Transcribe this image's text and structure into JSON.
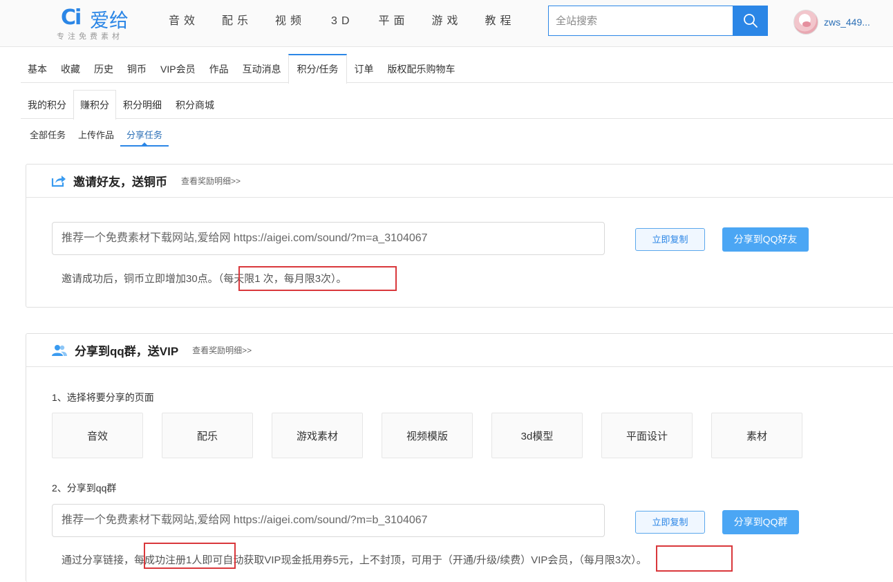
{
  "header": {
    "logo_mark": "Ci",
    "logo_name": "爱给",
    "logo_slogan": "专注免费素材",
    "nav": [
      "音效",
      "配乐",
      "视频",
      "3D",
      "平面",
      "游戏",
      "教程"
    ],
    "search_placeholder": "全站搜索",
    "username": "zws_449..."
  },
  "tabs_primary": {
    "items": [
      "基本",
      "收藏",
      "历史",
      "铜币",
      "VIP会员",
      "作品",
      "互动消息",
      "积分/任务",
      "订单",
      "版权配乐购物车"
    ],
    "active": "积分/任务"
  },
  "tabs_secondary": {
    "items": [
      "我的积分",
      "赚积分",
      "积分明细",
      "积分商城"
    ],
    "active": "赚积分"
  },
  "tabs_tertiary": {
    "items": [
      "全部任务",
      "上传作品",
      "分享任务"
    ],
    "active": "分享任务"
  },
  "invite": {
    "title": "邀请好友，送铜币",
    "detail_link": "查看奖励明细>>",
    "link_text": "推荐一个免费素材下载网站,爱给网   https://aigei.com/sound/?m=a_3104067",
    "copy_button": "立即复制",
    "share_button": "分享到QQ好友",
    "note_prefix": "邀请成功后，铜币立即增加30点。",
    "note_limit": "（每天限1 次，每月限3次）",
    "note_end": "。"
  },
  "share_group": {
    "title": "分享到qq群，送VIP",
    "detail_link": "查看奖励明细>>",
    "step1": "1、选择将要分享的页面",
    "categories": [
      "音效",
      "配乐",
      "游戏素材",
      "视频模版",
      "3d模型",
      "平面设计",
      "素材"
    ],
    "step2": "2、分享到qq群",
    "link_text": "推荐一个免费素材下载网站,爱给网   https://aigei.com/sound/?m=b_3104067",
    "copy_button": "立即复制",
    "share_button": "分享到QQ群",
    "note_a": "通过分享链接，",
    "note_b": "每成功注册1人即",
    "note_c": "可自动获取VIP现金抵用券5元，上不封顶，可用于（开通/升级/续费）VIP会员，",
    "note_limit": "（每月限3次）",
    "note_end": "。"
  },
  "colors": {
    "accent": "#2b86e6",
    "button_blue": "#4ba6f4",
    "highlight_red": "#d9373b"
  }
}
